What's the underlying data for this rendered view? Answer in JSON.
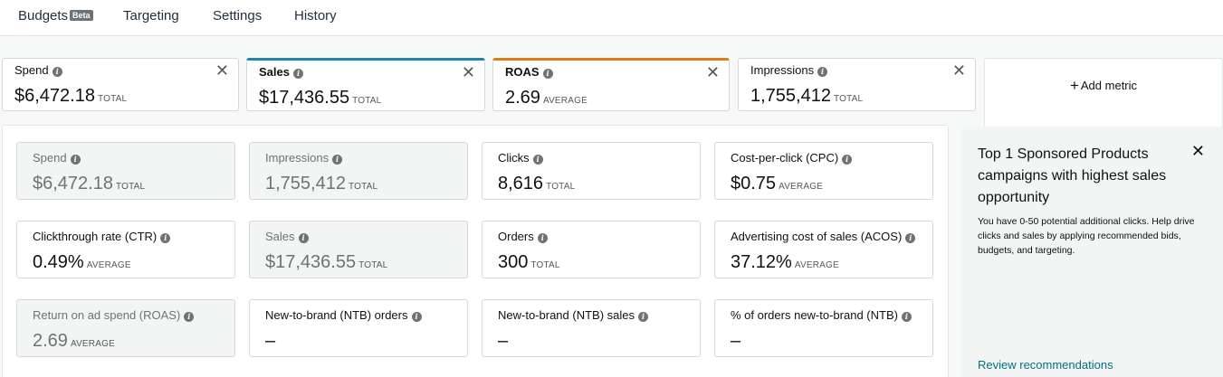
{
  "nav": {
    "budgets": "Budgets",
    "beta": "Beta",
    "targeting": "Targeting",
    "settings": "Settings",
    "history": "History"
  },
  "selected_metrics": [
    {
      "label": "Spend",
      "value": "$6,472.18",
      "unit": "TOTAL"
    },
    {
      "label": "Sales",
      "value": "$17,436.55",
      "unit": "TOTAL",
      "accent": "#1f87ab"
    },
    {
      "label": "ROAS",
      "value": "2.69",
      "unit": "AVERAGE",
      "accent": "#e07c14"
    },
    {
      "label": "Impressions",
      "value": "1,755,412",
      "unit": "TOTAL"
    }
  ],
  "add_metric": "Add metric",
  "metrics": [
    {
      "label": "Spend",
      "value": "$6,472.18",
      "unit": "TOTAL",
      "disabled": true
    },
    {
      "label": "Impressions",
      "value": "1,755,412",
      "unit": "TOTAL",
      "disabled": true
    },
    {
      "label": "Clicks",
      "value": "8,616",
      "unit": "TOTAL"
    },
    {
      "label": "Cost-per-click (CPC)",
      "value": "$0.75",
      "unit": "AVERAGE"
    },
    {
      "label": "Clickthrough rate (CTR)",
      "value": "0.49%",
      "unit": "AVERAGE"
    },
    {
      "label": "Sales",
      "value": "$17,436.55",
      "unit": "TOTAL",
      "disabled": true
    },
    {
      "label": "Orders",
      "value": "300",
      "unit": "TOTAL"
    },
    {
      "label": "Advertising cost of sales (ACOS)",
      "value": "37.12%",
      "unit": "AVERAGE"
    },
    {
      "label": "Return on ad spend (ROAS)",
      "value": "2.69",
      "unit": "AVERAGE",
      "disabled": true
    },
    {
      "label": "New-to-brand (NTB) orders",
      "value": "–",
      "unit": ""
    },
    {
      "label": "New-to-brand (NTB) sales",
      "value": "–",
      "unit": ""
    },
    {
      "label": "% of orders new-to-brand (NTB)",
      "value": "–",
      "unit": ""
    }
  ],
  "recommendation": {
    "title": "Top 1 Sponsored Products campaigns with highest sales opportunity",
    "description": "You have 0-50 potential additional clicks. Help drive clicks and sales by applying recommended bids, budgets, and targeting.",
    "link": "Review recommendations"
  },
  "colors": {
    "sales_accent": "#1f87ab",
    "roas_accent": "#e07c14",
    "link": "#007185"
  }
}
